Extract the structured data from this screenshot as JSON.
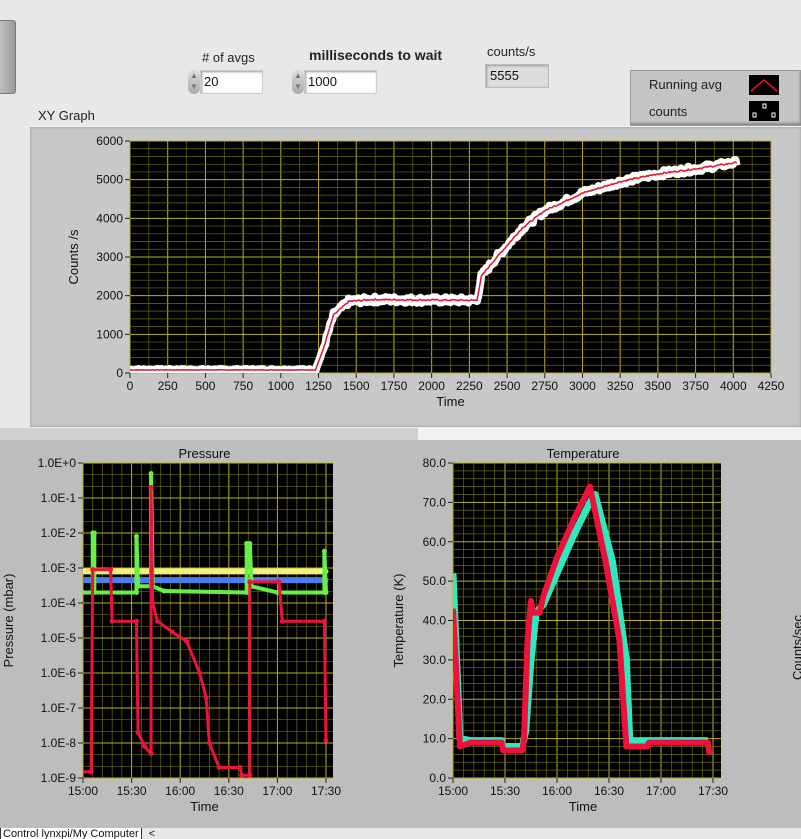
{
  "controls": {
    "avgs_label": "# of avgs",
    "avgs_value": "20",
    "wait_label": "milliseconds to wait",
    "wait_value": "1000",
    "counts_label": "counts/s",
    "counts_value": "5555"
  },
  "legend": {
    "items": [
      {
        "label": "Running avg",
        "color": "#e8102a"
      },
      {
        "label": "counts",
        "color": "#ffffff"
      }
    ]
  },
  "xy_graph": {
    "title": "XY Graph"
  },
  "side_label": "Counts/sec",
  "status_bar": {
    "text": "Control lynxpi/My Computer",
    "arrow": "<"
  },
  "chart_data": [
    {
      "type": "line",
      "title": "XY Graph",
      "xlabel": "Time",
      "ylabel": "Counts /s",
      "xlim": [
        0,
        4250
      ],
      "ylim": [
        0,
        6000
      ],
      "x_ticks": [
        "0",
        "250",
        "500",
        "750",
        "1000",
        "1250",
        "1500",
        "1750",
        "2000",
        "2250",
        "2500",
        "2750",
        "3000",
        "3250",
        "3500",
        "3750",
        "4000",
        "4250"
      ],
      "y_ticks": [
        "0",
        "1000",
        "2000",
        "3000",
        "4000",
        "5000",
        "6000"
      ],
      "grid": true,
      "series": [
        {
          "name": "counts",
          "color": "#ffffff",
          "points": [
            [
              0,
              80
            ],
            [
              1230,
              80
            ],
            [
              1280,
              600
            ],
            [
              1350,
              1500
            ],
            [
              1450,
              1850
            ],
            [
              1600,
              1900
            ],
            [
              2300,
              1880
            ],
            [
              2330,
              2500
            ],
            [
              2400,
              2850
            ],
            [
              2500,
              3300
            ],
            [
              2600,
              3750
            ],
            [
              2750,
              4200
            ],
            [
              3000,
              4650
            ],
            [
              3250,
              4950
            ],
            [
              3500,
              5150
            ],
            [
              3750,
              5280
            ],
            [
              4030,
              5450
            ]
          ]
        },
        {
          "name": "Running avg",
          "color": "#e8102a",
          "points": [
            [
              0,
              80
            ],
            [
              1230,
              80
            ],
            [
              1280,
              600
            ],
            [
              1350,
              1500
            ],
            [
              1450,
              1850
            ],
            [
              1600,
              1900
            ],
            [
              2300,
              1880
            ],
            [
              2330,
              2500
            ],
            [
              2400,
              2850
            ],
            [
              2500,
              3300
            ],
            [
              2600,
              3750
            ],
            [
              2750,
              4200
            ],
            [
              3000,
              4650
            ],
            [
              3250,
              4950
            ],
            [
              3500,
              5150
            ],
            [
              3750,
              5280
            ],
            [
              4030,
              5450
            ]
          ]
        }
      ]
    },
    {
      "type": "line",
      "title": "Pressure",
      "xlabel": "Time",
      "ylabel": "Pressure (mbar)",
      "yscale": "log",
      "xlim_minutes_after_15_00": [
        0,
        150
      ],
      "ylim": [
        1e-09,
        1
      ],
      "x_ticks": [
        "15:00",
        "15:30",
        "16:00",
        "16:30",
        "17:00",
        "17:30"
      ],
      "y_ticks": [
        "1.0E+0",
        "1.0E-1",
        "1.0E-2",
        "1.0E-3",
        "1.0E-4",
        "1.0E-5",
        "1.0E-6",
        "1.0E-7",
        "1.0E-8",
        "1.0E-9"
      ],
      "grid": true,
      "series": [
        {
          "name": "yellow",
          "color": "#f4f07a",
          "points": [
            [
              0,
              0.0008
            ],
            [
              150,
              0.0008
            ]
          ]
        },
        {
          "name": "blue",
          "color": "#4a7ef0",
          "points": [
            [
              0,
              0.00045
            ],
            [
              150,
              0.00045
            ]
          ]
        },
        {
          "name": "green",
          "color": "#66f046",
          "points": [
            [
              0,
              0.0002
            ],
            [
              6,
              0.0002
            ],
            [
              6,
              0.01
            ],
            [
              7,
              0.01
            ],
            [
              7,
              0.0002
            ],
            [
              33,
              0.0002
            ],
            [
              33,
              0.008
            ],
            [
              34,
              0.0003
            ],
            [
              42,
              0.0003
            ],
            [
              42,
              0.5
            ],
            [
              43,
              0.0003
            ],
            [
              50,
              0.00022
            ],
            [
              101,
              0.0002
            ],
            [
              101,
              0.005
            ],
            [
              103,
              0.005
            ],
            [
              104,
              0.0003
            ],
            [
              120,
              0.0002
            ],
            [
              149,
              0.0002
            ],
            [
              149,
              0.003
            ],
            [
              150,
              0.0002
            ]
          ]
        },
        {
          "name": "red",
          "color": "#f0103c",
          "points": [
            [
              0,
              1.5e-09
            ],
            [
              5,
              1.5e-09
            ],
            [
              6,
              0.0009
            ],
            [
              17,
              0.0009
            ],
            [
              18,
              3e-05
            ],
            [
              33,
              3e-05
            ],
            [
              34,
              2e-08
            ],
            [
              38,
              8e-09
            ],
            [
              42,
              5e-09
            ],
            [
              42,
              0.2
            ],
            [
              43,
              0.0001
            ],
            [
              46,
              3e-05
            ],
            [
              55,
              1.5e-05
            ],
            [
              64,
              8e-06
            ],
            [
              72,
              1e-06
            ],
            [
              76,
              2e-07
            ],
            [
              78,
              1e-08
            ],
            [
              84,
              2e-09
            ],
            [
              97,
              2e-09
            ],
            [
              98,
              1.2e-09
            ],
            [
              103,
              1.2e-09
            ],
            [
              103,
              0.0004
            ],
            [
              121,
              0.0004
            ],
            [
              123,
              3e-05
            ],
            [
              149,
              3e-05
            ],
            [
              150,
              1.2e-08
            ]
          ]
        }
      ]
    },
    {
      "type": "line",
      "title": "Temperature",
      "xlabel": "Time",
      "ylabel": "Temperature (K)",
      "xlim_minutes_after_15_00": [
        0,
        150
      ],
      "ylim": [
        0,
        80
      ],
      "x_ticks": [
        "15:00",
        "15:30",
        "16:00",
        "16:30",
        "17:00",
        "17:30"
      ],
      "y_ticks": [
        "0.0",
        "10.0",
        "20.0",
        "30.0",
        "40.0",
        "50.0",
        "60.0",
        "70.0",
        "80.0"
      ],
      "grid": true,
      "series": [
        {
          "name": "cyan",
          "color": "#2ee8c0",
          "points": [
            [
              0,
              52
            ],
            [
              4,
              10
            ],
            [
              10,
              9.5
            ],
            [
              28,
              9.5
            ],
            [
              29,
              8
            ],
            [
              40,
              8
            ],
            [
              42,
              12
            ],
            [
              45,
              30
            ],
            [
              48,
              42
            ],
            [
              52,
              44
            ],
            [
              60,
              52
            ],
            [
              70,
              62
            ],
            [
              79,
              70
            ],
            [
              82,
              72
            ],
            [
              92,
              55
            ],
            [
              100,
              30
            ],
            [
              102,
              9.5
            ],
            [
              147,
              9.5
            ]
          ]
        },
        {
          "name": "red",
          "color": "#f0103c",
          "points": [
            [
              0,
              43
            ],
            [
              4,
              8
            ],
            [
              10,
              9
            ],
            [
              28,
              9
            ],
            [
              29,
              7
            ],
            [
              40,
              7
            ],
            [
              41,
              10
            ],
            [
              43,
              35
            ],
            [
              45,
              45
            ],
            [
              46,
              42
            ],
            [
              50,
              42
            ],
            [
              52,
              46
            ],
            [
              60,
              56
            ],
            [
              70,
              66
            ],
            [
              79,
              74
            ],
            [
              88,
              55
            ],
            [
              96,
              35
            ],
            [
              100,
              8
            ],
            [
              112,
              8
            ],
            [
              113,
              9
            ],
            [
              147,
              9
            ],
            [
              148,
              6
            ]
          ]
        }
      ]
    }
  ]
}
